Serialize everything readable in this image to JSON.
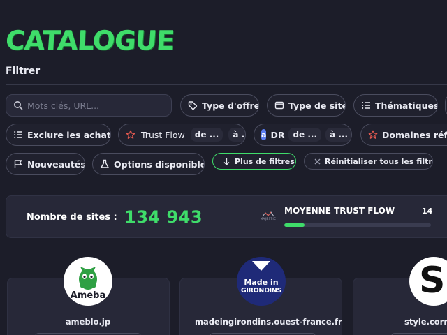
{
  "page": {
    "title": "CATALOGUE",
    "filter_title": "Filtrer"
  },
  "filters": {
    "search_placeholder": "Mots clés, URL...",
    "type_offre": "Type d'offre",
    "type_site": "Type de site",
    "thematiques": "Thématiques",
    "exclure_achats": "Exclure les achats",
    "trust_flow": {
      "label": "Trust Flow",
      "from": "de ...",
      "to": "à ..."
    },
    "dr": {
      "badge": "a",
      "label": "DR",
      "from": "de ...",
      "to": "à ..."
    },
    "domaines_referents": "Domaines référ",
    "nouveautes": "Nouveautés",
    "options_disponibles": "Options disponibles",
    "plus_de_filtres": "Plus de filtres",
    "reinitialiser": "Réinitialiser tous les filtres"
  },
  "stats": {
    "sites_label": "Nombre de sites :",
    "sites_count": "134 943",
    "majestic_text": "MAJESTIC",
    "tf_title": "MOYENNE TRUST FLOW",
    "tf_value": "14",
    "tf_progress": 0.14
  },
  "cards": [
    {
      "domain": "ameblo.jp",
      "logo_text": "Ameba",
      "logo_bg": "#ffffff",
      "logo_color": "#2ea043"
    },
    {
      "domain": "madeingirondins.ouest-france.fr",
      "logo_text_1": "Made in",
      "logo_text_2": "GIRONDINS",
      "logo_bg": "#1f2a78"
    },
    {
      "domain": "style.corrie",
      "logo_text": "S",
      "logo_bg": "#ffffff"
    }
  ],
  "colors": {
    "accent": "#3fdc6a",
    "background": "#1c1d29",
    "panel": "#272838"
  }
}
